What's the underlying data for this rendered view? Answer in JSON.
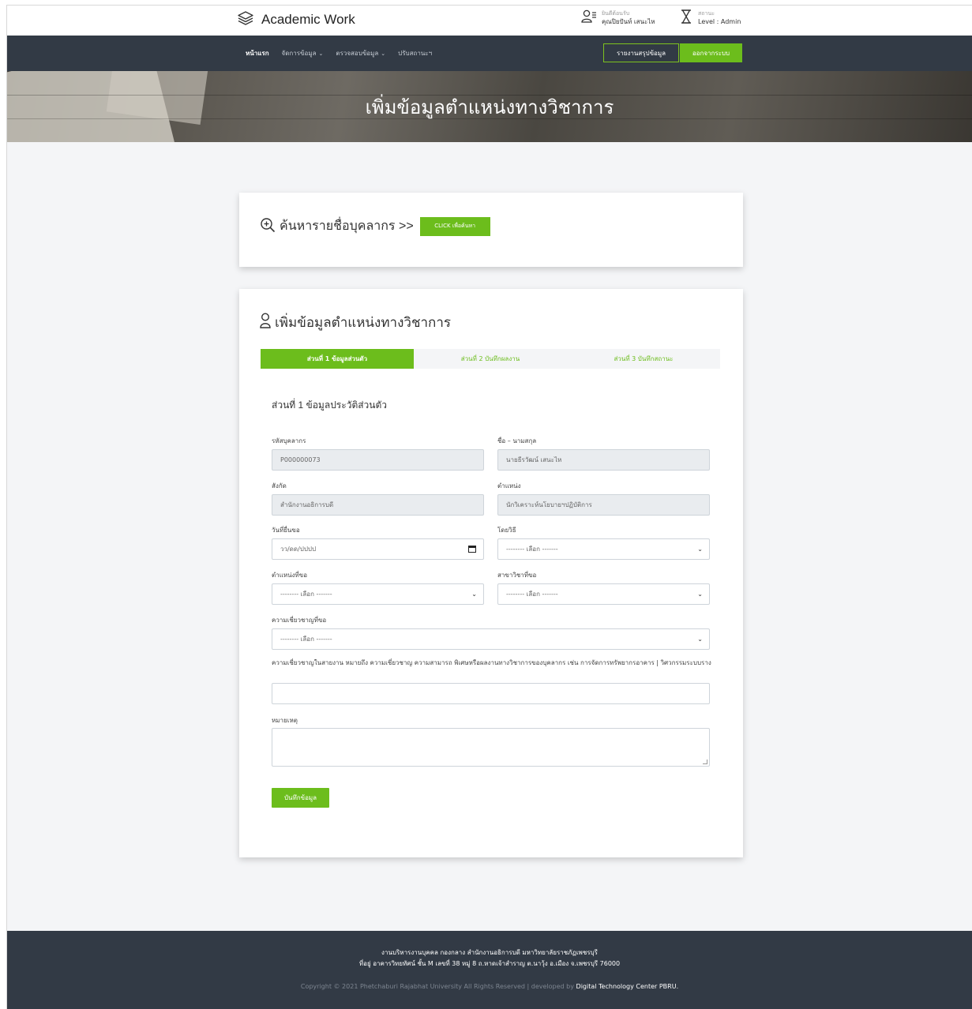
{
  "header": {
    "brand": "Academic Work",
    "user_label": "ยินดีต้อนรับ",
    "user_name": "คุณปิยปันท์ เสนะไห",
    "status_label": "สถานะ",
    "status_value": "Level : Admin"
  },
  "nav": {
    "items": [
      {
        "label": "หน้าแรก",
        "has_caret": false,
        "active": true
      },
      {
        "label": "จัดการข้อมูล",
        "has_caret": true,
        "active": false
      },
      {
        "label": "ตรวจสอบข้อมูล",
        "has_caret": true,
        "active": false
      },
      {
        "label": "ปรับสถานะฯ",
        "has_caret": false,
        "active": false
      }
    ],
    "report_button": "รายงานสรุปข้อมูล",
    "logout_button": "ออกจากระบบ"
  },
  "banner": {
    "title": "เพิ่มข้อมูลตำแหน่งทางวิชาการ"
  },
  "search": {
    "label": "ค้นหารายชื่อบุคลากร >>",
    "button": "CLICK เพื่อค้นหา"
  },
  "form": {
    "title": "เพิ่มข้อมูลตำแหน่งทางวิชาการ",
    "tabs": [
      {
        "label": "ส่วนที่ 1 ข้อมูลส่วนตัว",
        "active": true
      },
      {
        "label": "ส่วนที่ 2 บันทึกผลงาน",
        "active": false
      },
      {
        "label": "ส่วนที่ 3 บันทึกสถานะ",
        "active": false
      }
    ],
    "section_heading": "ส่วนที่ 1 ข้อมูลประวัติส่วนตัว",
    "fields": {
      "staff_id": {
        "label": "รหัสบุคลากร",
        "value": "P000000073"
      },
      "full_name": {
        "label": "ชื่อ – นามสกุล",
        "value": "นายธีรวัฒน์ เสนะไห"
      },
      "affiliation": {
        "label": "สังกัด",
        "value": "สำนักงานอธิการบดี"
      },
      "position": {
        "label": "ตำแหน่ง",
        "value": "นักวิเคราะห์นโยบายฯปฏิบัติการ"
      },
      "submit_date": {
        "label": "วันที่ยื่นขอ",
        "placeholder": "วว/ดด/ปปปป"
      },
      "method": {
        "label": "โดยวิธี",
        "value": "-------- เลือก -------"
      },
      "requested_position": {
        "label": "ตำแหน่งที่ขอ",
        "value": "-------- เลือก -------"
      },
      "requested_field": {
        "label": "สาขาวิชาที่ขอ",
        "value": "-------- เลือก -------"
      },
      "expertise": {
        "label": "ความเชี่ยวชาญที่ขอ",
        "value": "-------- เลือก -------"
      },
      "remark": {
        "label": "หมายเหตุ"
      }
    },
    "expertise_note": "ความเชี่ยวชาญในสายงาน หมายถึง ความเชี่ยวชาญ ความสามารถ พิเศษหรือผลงานทางวิชาการของบุคลากร เช่น การจัดการทรัพยากรอาคาร | วิศวกรรมระบบราง",
    "save_button": "บันทึกข้อมูล"
  },
  "footer": {
    "line1": "งานบริหารงานบุคคล กองกลาง สำนักงานอธิการบดี มหาวิทยาลัยราชภัฏเพชรบุรี",
    "line2": "ที่อยู่ อาคารวิทยทัศน์ ชั้น M เลขที่ 38 หมู่ 8 ถ.หาดเจ้าสำราญ ต.นาวุ้ง อ.เมือง จ.เพชรบุรี 76000",
    "copyright": "Copyright © 2021 Phetchaburi Rajabhat University All Rights Reserved | developed by",
    "developer": "Digital Technology Center PBRU."
  },
  "colors": {
    "accent": "#6cbd1c",
    "nav_bg": "#323a45",
    "page_bg": "#f4f5f7"
  },
  "icons": {
    "brand": "layers-icon",
    "user": "user-list-icon",
    "status": "hourglass-icon",
    "search": "zoom-in-icon",
    "form": "user-icon",
    "date": "calendar-icon",
    "select": "chevron-down-icon"
  }
}
